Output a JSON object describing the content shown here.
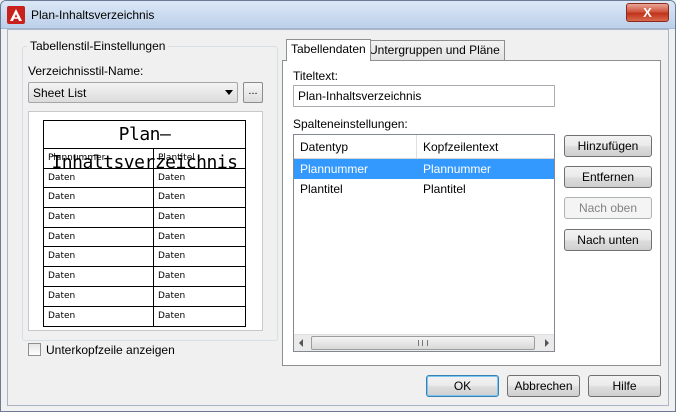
{
  "window": {
    "title": "Plan-Inhaltsverzeichnis",
    "close_glyph": "X"
  },
  "left": {
    "group_title": "Tabellenstil-Einstellungen",
    "style_name_label": "Verzeichnisstil-Name:",
    "style_name_value": "Sheet List",
    "browse_label": "...",
    "preview": {
      "title": "Plan–Inhaltsverzeichnis",
      "headers": [
        "Plannummer",
        "Plantitel"
      ],
      "rows": [
        [
          "Daten",
          "Daten"
        ],
        [
          "Daten",
          "Daten"
        ],
        [
          "Daten",
          "Daten"
        ],
        [
          "Daten",
          "Daten"
        ],
        [
          "Daten",
          "Daten"
        ],
        [
          "Daten",
          "Daten"
        ],
        [
          "Daten",
          "Daten"
        ],
        [
          "Daten",
          "Daten"
        ]
      ]
    },
    "subheader_checkbox_label": "Unterkopfzeile anzeigen",
    "subheader_checked": false
  },
  "tabs": [
    {
      "label": "Tabellendaten",
      "active": true
    },
    {
      "label": "Untergruppen und Pläne",
      "active": false
    }
  ],
  "panel": {
    "title_label": "Titeltext:",
    "title_value": "Plan-Inhaltsverzeichnis",
    "columns_label": "Spalteneinstellungen:",
    "list_headers": [
      "Datentyp",
      "Kopfzeilentext"
    ],
    "list_rows": [
      {
        "type": "Plannummer",
        "header": "Plannummer",
        "selected": true
      },
      {
        "type": "Plantitel",
        "header": "Plantitel",
        "selected": false
      }
    ],
    "buttons": {
      "add": "Hinzufügen",
      "remove": "Entfernen",
      "move_up": "Nach oben",
      "move_down": "Nach unten"
    }
  },
  "footer": {
    "ok": "OK",
    "cancel": "Abbrechen",
    "help": "Hilfe"
  }
}
